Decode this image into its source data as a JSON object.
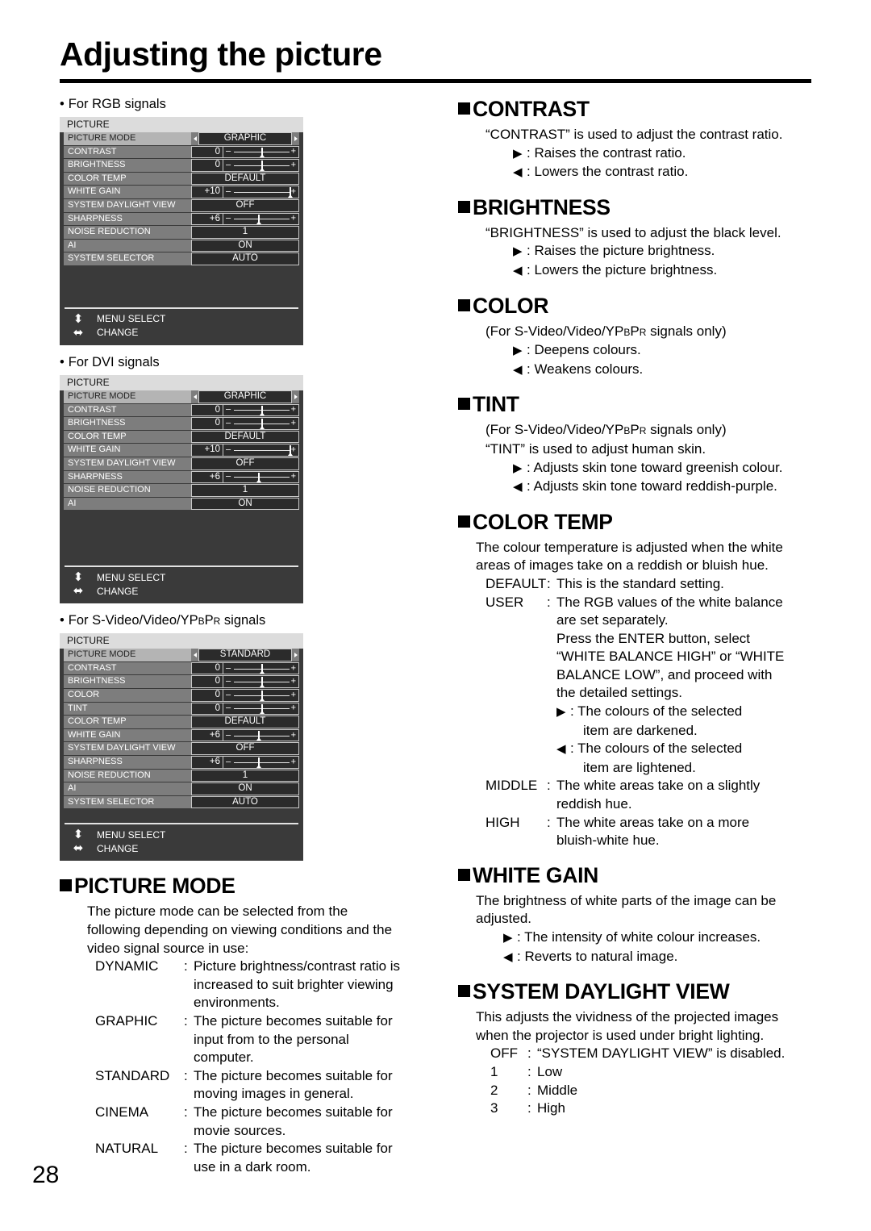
{
  "page": {
    "title": "Adjusting the picture",
    "number": "28"
  },
  "menus": [
    {
      "caption_bullet": "•",
      "caption": "For RGB signals",
      "title": "PICTURE",
      "rows": [
        {
          "label": "PICTURE MODE",
          "type": "choice",
          "value": "GRAPHIC",
          "highlight": true,
          "arrows": true
        },
        {
          "label": "CONTRAST",
          "type": "slider",
          "value": "0",
          "pos": 50
        },
        {
          "label": "BRIGHTNESS",
          "type": "slider",
          "value": "0",
          "pos": 50
        },
        {
          "label": "COLOR TEMP",
          "type": "value",
          "value": "DEFAULT"
        },
        {
          "label": "WHITE GAIN",
          "type": "slider",
          "value": "+10",
          "pos": 92
        },
        {
          "label": "SYSTEM DAYLIGHT VIEW",
          "type": "value",
          "value": "OFF"
        },
        {
          "label": "SHARPNESS",
          "type": "slider",
          "value": "+6",
          "pos": 47
        },
        {
          "label": "NOISE REDUCTION",
          "type": "value",
          "value": "1"
        },
        {
          "label": "AI",
          "type": "value",
          "value": "ON"
        },
        {
          "label": "SYSTEM SELECTOR",
          "type": "value",
          "value": "AUTO"
        }
      ],
      "blank_rows": 2,
      "footer": [
        {
          "glyph": "⬍",
          "text": "MENU SELECT"
        },
        {
          "glyph": "⬌",
          "text": "CHANGE"
        }
      ]
    },
    {
      "caption_bullet": "•",
      "caption": "For DVI signals",
      "title": "PICTURE",
      "rows": [
        {
          "label": "PICTURE MODE",
          "type": "choice",
          "value": "GRAPHIC",
          "highlight": true,
          "arrows": true
        },
        {
          "label": "CONTRAST",
          "type": "slider",
          "value": "0",
          "pos": 50
        },
        {
          "label": "BRIGHTNESS",
          "type": "slider",
          "value": "0",
          "pos": 50
        },
        {
          "label": "COLOR TEMP",
          "type": "value",
          "value": "DEFAULT"
        },
        {
          "label": "WHITE GAIN",
          "type": "slider",
          "value": "+10",
          "pos": 92
        },
        {
          "label": "SYSTEM DAYLIGHT VIEW",
          "type": "value",
          "value": "OFF"
        },
        {
          "label": "SHARPNESS",
          "type": "slider",
          "value": "+6",
          "pos": 47
        },
        {
          "label": "NOISE REDUCTION",
          "type": "value",
          "value": "1"
        },
        {
          "label": "AI",
          "type": "value",
          "value": "ON"
        }
      ],
      "blank_rows": 3,
      "footer": [
        {
          "glyph": "⬍",
          "text": "MENU SELECT"
        },
        {
          "glyph": "⬌",
          "text": "CHANGE"
        }
      ]
    },
    {
      "caption_bullet": "•",
      "caption_rich": true,
      "caption_pre": "For S-Video/Video/YP",
      "caption_sub1": "B",
      "caption_mid": "P",
      "caption_sub2": "R",
      "caption_post": " signals",
      "caption": "For S-Video/Video/YPBPR signals",
      "title": "PICTURE",
      "rows": [
        {
          "label": "PICTURE MODE",
          "type": "choice",
          "value": "STANDARD",
          "highlight": true,
          "arrows": true
        },
        {
          "label": "CONTRAST",
          "type": "slider",
          "value": "0",
          "pos": 50
        },
        {
          "label": "BRIGHTNESS",
          "type": "slider",
          "value": "0",
          "pos": 50
        },
        {
          "label": "COLOR",
          "type": "slider",
          "value": "0",
          "pos": 50
        },
        {
          "label": "TINT",
          "type": "slider",
          "value": "0",
          "pos": 50
        },
        {
          "label": "COLOR TEMP",
          "type": "value",
          "value": "DEFAULT"
        },
        {
          "label": "WHITE GAIN",
          "type": "slider",
          "value": "+6",
          "pos": 47
        },
        {
          "label": "SYSTEM DAYLIGHT VIEW",
          "type": "value",
          "value": "OFF"
        },
        {
          "label": "SHARPNESS",
          "type": "slider",
          "value": "+6",
          "pos": 47
        },
        {
          "label": "NOISE REDUCTION",
          "type": "value",
          "value": "1"
        },
        {
          "label": "AI",
          "type": "value",
          "value": "ON"
        },
        {
          "label": "SYSTEM SELECTOR",
          "type": "value",
          "value": "AUTO"
        }
      ],
      "blank_rows": 0,
      "footer": [
        {
          "glyph": "⬍",
          "text": "MENU SELECT"
        },
        {
          "glyph": "⬌",
          "text": "CHANGE"
        }
      ]
    }
  ],
  "picture_mode": {
    "heading": "PICTURE MODE",
    "intro_line1": "The picture mode can be selected from the",
    "intro_line2": "following depending on viewing conditions and the",
    "intro_line3": "video signal source in use:",
    "items": [
      {
        "term": "DYNAMIC",
        "colon": ":",
        "desc_line1": "Picture brightness/contrast ratio is",
        "desc_line2": "increased to suit brighter viewing",
        "desc_line3": "environments."
      },
      {
        "term": "GRAPHIC",
        "colon": ":",
        "desc_line1": "The picture becomes suitable for",
        "desc_line2": "input from to the personal",
        "desc_line3": "computer."
      },
      {
        "term": "STANDARD",
        "colon": ":",
        "desc_line1": "The picture becomes suitable for",
        "desc_line2": "moving images in general."
      },
      {
        "term": "CINEMA",
        "colon": ":",
        "desc_line1": "The picture becomes suitable for",
        "desc_line2": "movie sources."
      },
      {
        "term": "NATURAL",
        "colon": ":",
        "desc_line1": "The picture becomes suitable for",
        "desc_line2": "use in a dark room."
      }
    ]
  },
  "contrast": {
    "heading": "CONTRAST",
    "intro": "“CONTRAST” is used to adjust the contrast ratio.",
    "right_arrow": "▶",
    "left_arrow": "◀",
    "right_text": ": Raises the contrast ratio.",
    "left_text": ": Lowers the contrast ratio."
  },
  "brightness": {
    "heading": "BRIGHTNESS",
    "intro": "“BRIGHTNESS” is used to adjust the black level.",
    "right_arrow": "▶",
    "left_arrow": "◀",
    "right_text": ": Raises the picture brightness.",
    "left_text": ": Lowers the picture brightness."
  },
  "color": {
    "heading": "COLOR",
    "note_pre": "(For S-Video/Video/YP",
    "note_sub1": "B",
    "note_mid": "P",
    "note_sub2": "R",
    "note_post": " signals only)",
    "note": "(For S-Video/Video/YPBPR signals only)",
    "right_arrow": "▶",
    "left_arrow": "◀",
    "right_text": ": Deepens colours.",
    "left_text": ": Weakens colours."
  },
  "tint": {
    "heading": "TINT",
    "note_pre": "(For S-Video/Video/YP",
    "note_sub1": "B",
    "note_mid": "P",
    "note_sub2": "R",
    "note_post": " signals only)",
    "note": "(For S-Video/Video/YPBPR signals only)",
    "intro": "“TINT” is used to adjust human skin.",
    "right_arrow": "▶",
    "left_arrow": "◀",
    "right_text": ": Adjusts skin tone toward greenish colour.",
    "left_text": ": Adjusts skin tone toward reddish-purple."
  },
  "color_temp": {
    "heading": "COLOR TEMP",
    "intro_line1": "The colour temperature is adjusted when the white",
    "intro_line2": "areas of images take on a reddish or bluish hue.",
    "default_term": "DEFAULT",
    "default_colon": ":",
    "default_desc": "This is the standard setting.",
    "user_term": "USER",
    "user_colon": ":",
    "user_line1": "The RGB values of the white balance",
    "user_line2": "are set separately.",
    "user_line3": "Press the ENTER button, select",
    "user_line4": "“WHITE BALANCE HIGH” or “WHITE",
    "user_line5": "BALANCE LOW”, and proceed with",
    "user_line6": "the detailed settings.",
    "right_arrow": "▶",
    "left_arrow": "◀",
    "right_text_l1": ": The colours of the selected",
    "right_text_l2": "item are darkened.",
    "left_text_l1": ": The colours of the selected",
    "left_text_l2": "item are lightened.",
    "middle_term": "MIDDLE",
    "middle_colon": ":",
    "middle_line1": "The white areas take on a slightly",
    "middle_line2": "reddish hue.",
    "high_term": "HIGH",
    "high_colon": ":",
    "high_line1": "The white areas take on a more",
    "high_line2": "bluish-white hue."
  },
  "white_gain": {
    "heading": "WHITE GAIN",
    "intro_line1": "The brightness of white parts of the image can be",
    "intro_line2": "adjusted.",
    "right_arrow": "▶",
    "left_arrow": "◀",
    "right_text": ": The intensity of white colour increases.",
    "left_text": ": Reverts to natural image."
  },
  "system_daylight_view": {
    "heading": "SYSTEM DAYLIGHT VIEW",
    "intro_line1": "This adjusts the vividness of the projected images",
    "intro_line2": "when the projector is used under bright lighting.",
    "items": [
      {
        "term": "OFF",
        "colon": ":",
        "desc": "“SYSTEM DAYLIGHT VIEW” is disabled."
      },
      {
        "term": "1",
        "colon": ":",
        "desc": "Low"
      },
      {
        "term": "2",
        "colon": ":",
        "desc": "Middle"
      },
      {
        "term": "3",
        "colon": ":",
        "desc": "High"
      }
    ]
  }
}
